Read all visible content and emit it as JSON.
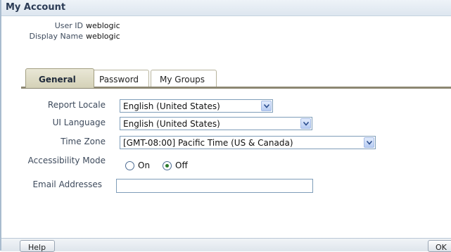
{
  "dialog": {
    "title": "My Account",
    "user_id_label": "User ID",
    "user_id": "weblogic",
    "display_name_label": "Display Name",
    "display_name": "weblogic"
  },
  "tabs": [
    {
      "label": "General",
      "active": true
    },
    {
      "label": "Password",
      "active": false
    },
    {
      "label": "My Groups",
      "active": false
    }
  ],
  "form": {
    "report_locale_label": "Report Locale",
    "report_locale_value": "English (United States)",
    "ui_language_label": "UI Language",
    "ui_language_value": "English (United States)",
    "time_zone_label": "Time Zone",
    "time_zone_value": "[GMT-08:00] Pacific Time (US & Canada)",
    "accessibility_label": "Accessibility Mode",
    "accessibility_on": "On",
    "accessibility_off": "Off",
    "accessibility_selected": "Off",
    "email_label": "Email Addresses",
    "email_value": ""
  },
  "footer": {
    "help_label": "Help",
    "ok_label": "OK"
  },
  "icons": {
    "dropdown": "chevron-down-icon"
  }
}
